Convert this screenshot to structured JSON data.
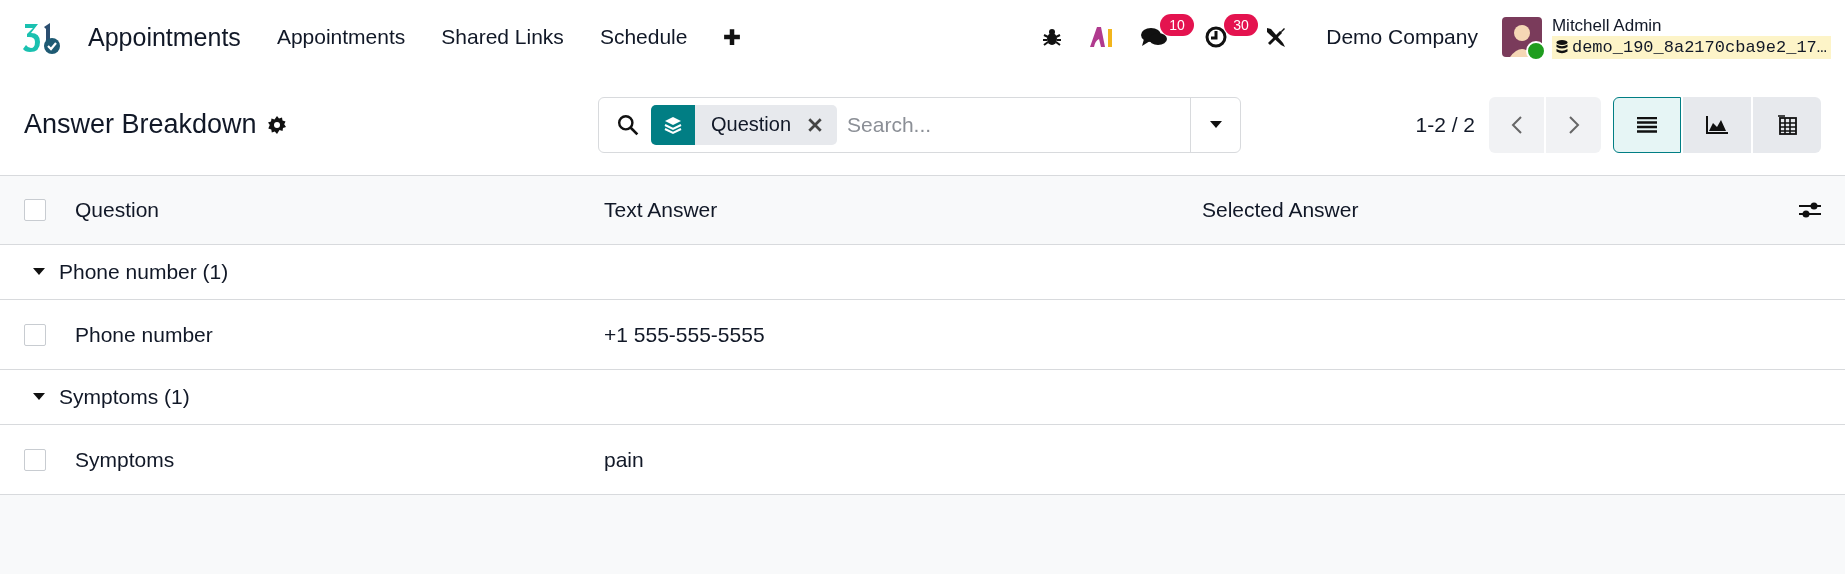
{
  "navbar": {
    "app_name": "Appointments",
    "menu": [
      "Appointments",
      "Shared Links",
      "Schedule"
    ],
    "message_count": "10",
    "activity_count": "30",
    "company": "Demo Company",
    "user": {
      "name": "Mitchell Admin",
      "database": "demo_190_8a2170cba9e2_17…",
      "online": true
    }
  },
  "control_panel": {
    "title": "Answer Breakdown",
    "search": {
      "facet": "Question",
      "placeholder": "Search..."
    },
    "pager": "1-2 / 2",
    "views": [
      {
        "kind": "list",
        "selected": true
      },
      {
        "kind": "graph",
        "selected": false
      },
      {
        "kind": "pivot",
        "selected": false
      }
    ]
  },
  "table": {
    "select_all_checked": false,
    "columns": [
      "Question",
      "Text Answer",
      "Selected Answer"
    ],
    "groups": [
      {
        "label": "Phone number (1)",
        "expanded": true,
        "rows": [
          {
            "cells": [
              "Phone number",
              "+1 555-555-5555",
              ""
            ],
            "checked": false
          }
        ]
      },
      {
        "label": "Symptoms (1)",
        "expanded": true,
        "rows": [
          {
            "cells": [
              "Symptoms",
              "pain",
              ""
            ],
            "checked": false
          }
        ]
      }
    ]
  }
}
